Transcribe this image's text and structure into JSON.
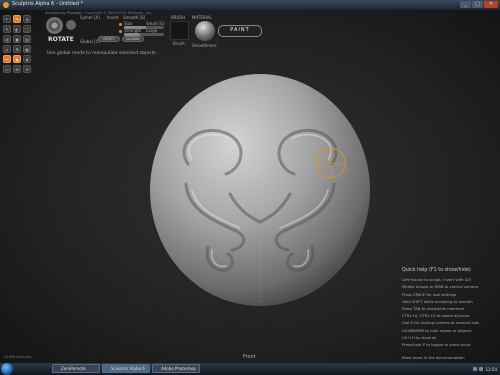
{
  "window": {
    "title": "Sculptris Alpha 6 - Untitled *",
    "min": "_",
    "max": "□",
    "close": "✕"
  },
  "topbar": {
    "menu": "Sculptris by Pixologic",
    "copyright": "Copyright © 2009-2011 Pixologic, Inc."
  },
  "tools": [
    "↶",
    "↷",
    "⊕",
    "✎",
    "◐",
    "⬚",
    "◍",
    "▣",
    "▤",
    "⌂",
    "⚙",
    "▦",
    "✂",
    "◉",
    "◈",
    "▭",
    "⊞",
    "✦"
  ],
  "rotate": {
    "label": "ROTATE",
    "symmetry": "Symm [X]",
    "invert": "Invert",
    "smooth": "Smooth [S]"
  },
  "brush_settings": {
    "size_label": "Size",
    "size_key": "Small [G]",
    "strength_label": "Strength",
    "strength_key": "Large",
    "size_level": 0.55,
    "strength_level": 0.4,
    "reset_label": "RESET",
    "global_label": "GLOBAL",
    "global_key": "Global [X]"
  },
  "brush": {
    "label": "BRUSH",
    "sub": "Brush"
  },
  "material": {
    "label": "MATERIAL",
    "sub": "Smoothness"
  },
  "paint_button": "PAINT",
  "hint": "Use global mode to manipulate selected objects",
  "help": {
    "title": "Quick help (F1 to show/hide)",
    "lines": [
      "Left mouse to sculpt, invert with ALT",
      "Middle mouse or RMB to control camera",
      "Press SPACE for tool settings",
      "Hold SHIFT while sculpting to smooth",
      "Press TAB to show/hide interface",
      "CTRL+A, CTRL+Z to select all/none",
      "Use Z for locking camera to nearest axis",
      "H/LMB/RMB to hide region or objects",
      "Ctrl+H to show all",
      "Press/hold P to toggle or place pivot"
    ],
    "link": "Read more in the documentation"
  },
  "view_label": "Front",
  "triangles": "24998 triangles",
  "taskbar": {
    "items": [
      "ZeroRemote",
      "Sculptris Alpha 6",
      "Adobe Photoshop"
    ],
    "clock": "13:54"
  },
  "colors": {
    "accent": "#d87a2a",
    "cursor": "#d8902a"
  }
}
